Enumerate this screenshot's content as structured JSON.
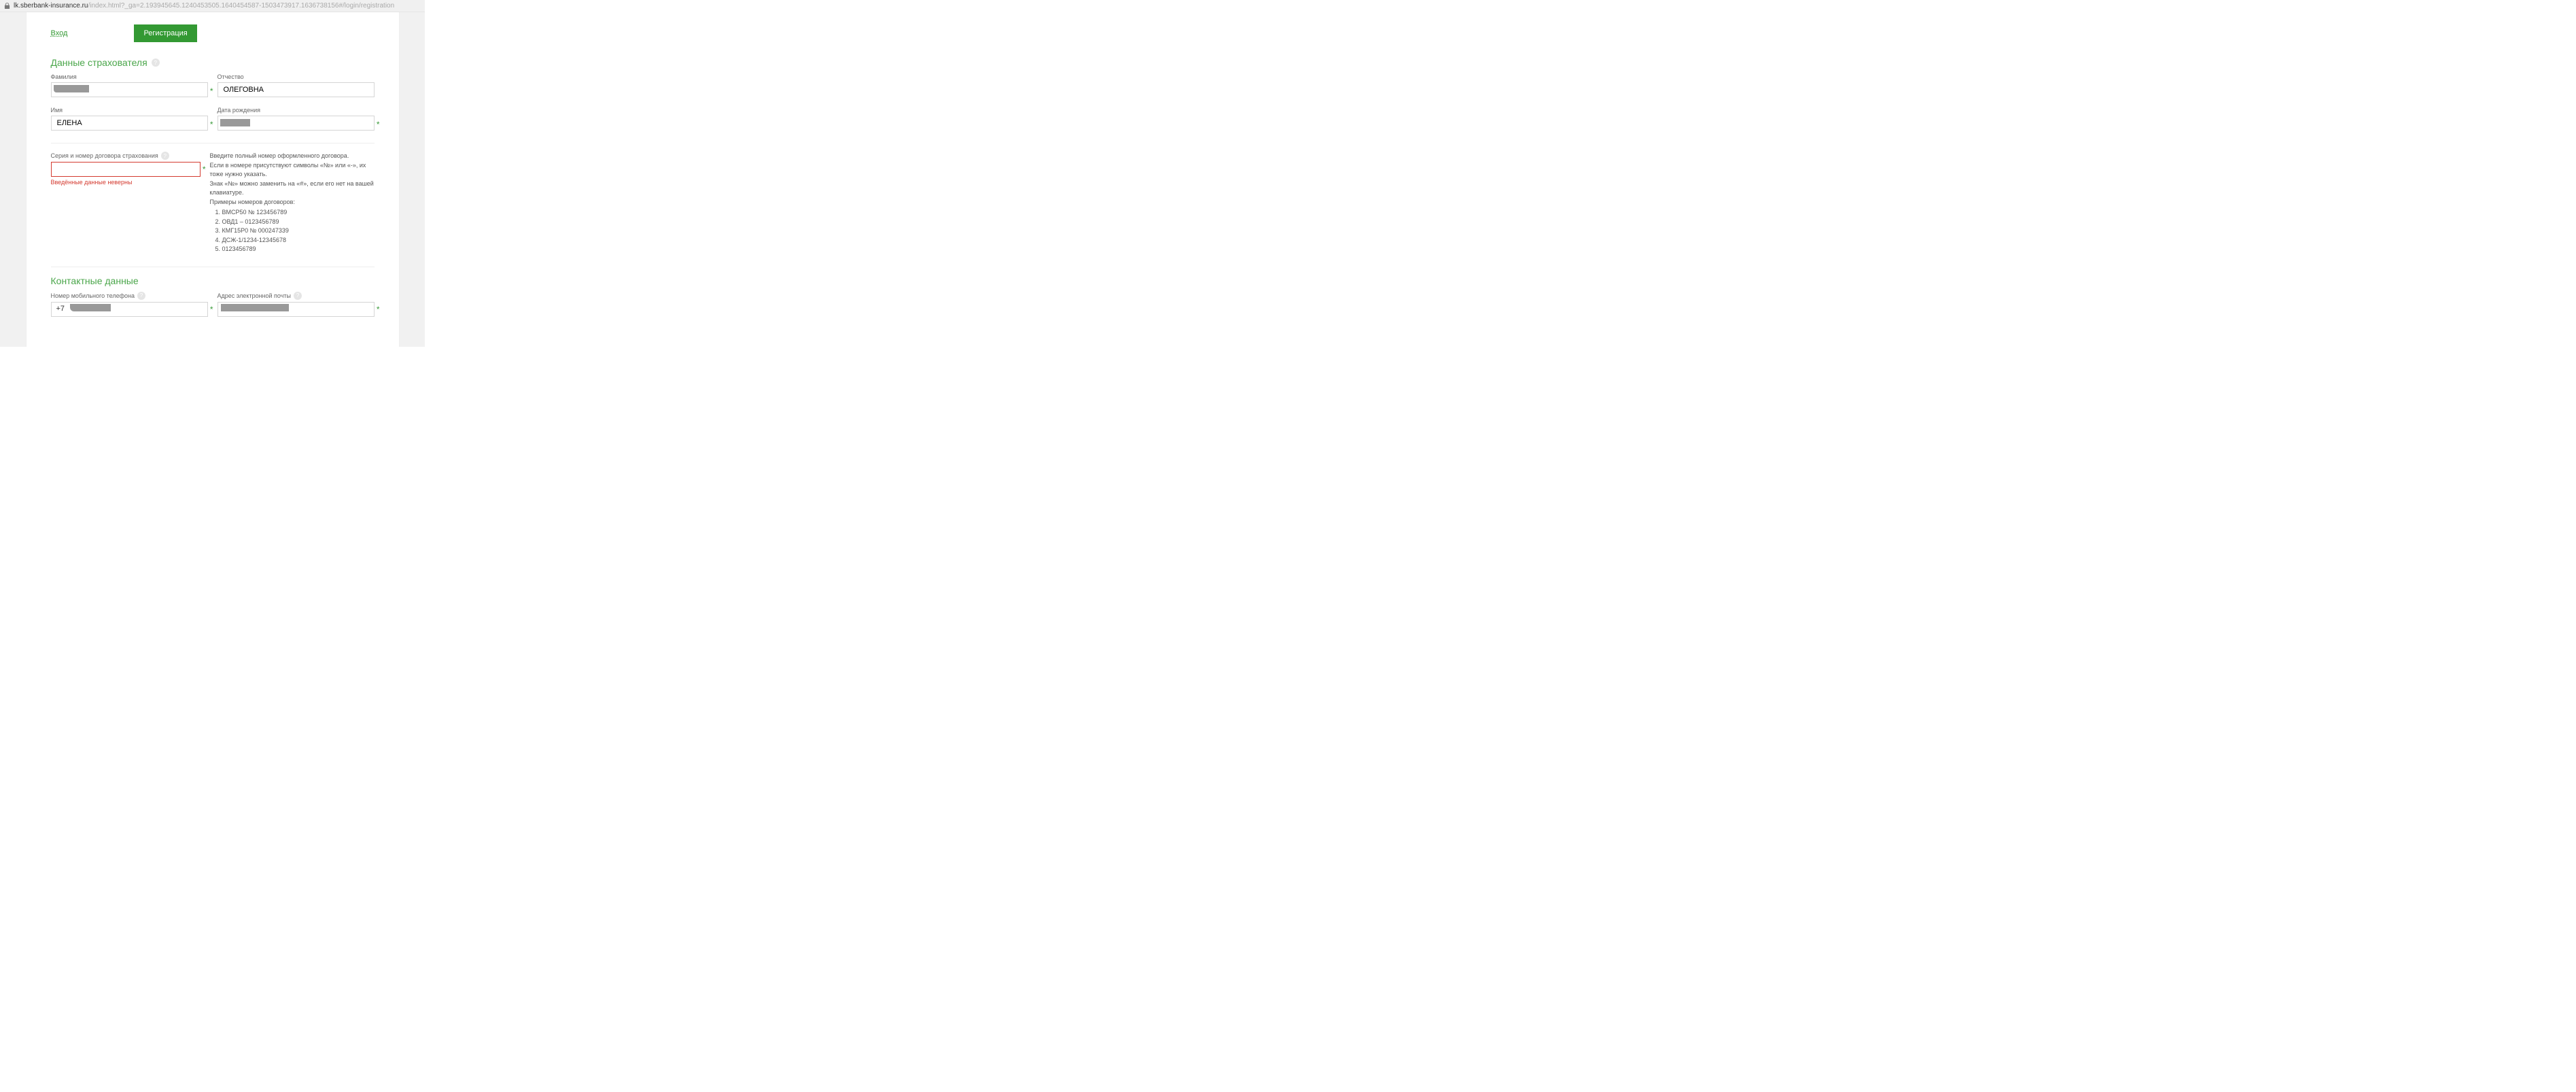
{
  "addressBar": {
    "host": "lk.sberbank-insurance.ru",
    "path": "/index.html?_ga=2.193945645.1240453505.1640454587-1503473917.1636738156#/login/registration"
  },
  "tabs": {
    "login_label": "Вход",
    "register_label": "Регистрация"
  },
  "sections": {
    "policyholder_title": "Данные страхователя",
    "contact_title": "Контактные данные"
  },
  "fields": {
    "lastname_label": "Фамилия",
    "lastname_value": "",
    "patronymic_label": "Отчество",
    "patronymic_value": "ОЛЕГОВНА",
    "firstname_label": "Имя",
    "firstname_value": "ЕЛЕНА",
    "dob_label": "Дата рождения",
    "dob_value": "",
    "contract_label": "Серия и номер договора страхования",
    "contract_value": "",
    "contract_error": "Введённые данные неверны",
    "phone_label": "Номер мобильного телефона",
    "phone_prefix": "+7",
    "phone_value": "",
    "email_label": "Адрес электронной почты",
    "email_value": ""
  },
  "contract_help": {
    "line1": "Введите полный номер оформленного договора.",
    "line2": "Если в номере присутствуют символы «№» или «-», их тоже нужно указать.",
    "line3": "Знак «№» можно заменить на «#», если его нет на вашей клавиатуре.",
    "examples_title": "Примеры номеров договоров:",
    "examples": [
      "ВМСР50 № 123456789",
      "ОВД1 – 0123456789",
      "КМГ15Р0 № 000247339",
      "ДСЖ-1/1234-12345678",
      "0123456789"
    ]
  },
  "required_mark": "*",
  "help_mark": "?"
}
